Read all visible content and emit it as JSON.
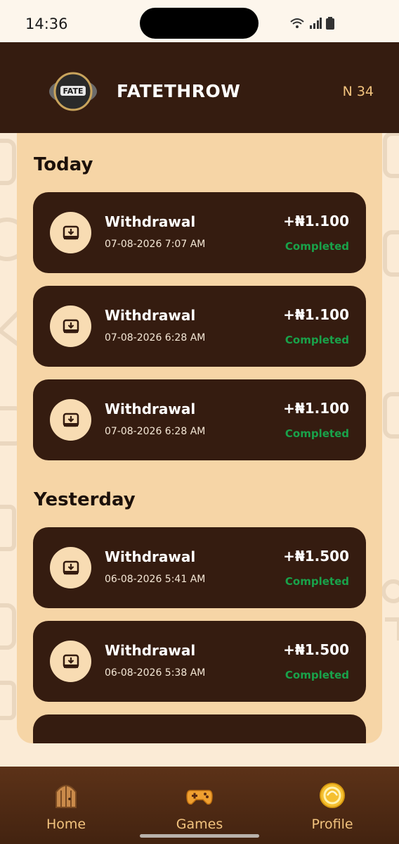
{
  "status_bar": {
    "time": "14:36"
  },
  "header": {
    "app_title": "FATETHROW",
    "logo_text": "FATE",
    "balance": "N 34"
  },
  "sections": [
    {
      "title": "Today",
      "transactions": [
        {
          "type": "Withdrawal",
          "date": "07-08-2026 7:07 AM",
          "amount": "+₦1.100",
          "status": "Completed"
        },
        {
          "type": "Withdrawal",
          "date": "07-08-2026 6:28 AM",
          "amount": "+₦1.100",
          "status": "Completed"
        },
        {
          "type": "Withdrawal",
          "date": "07-08-2026 6:28 AM",
          "amount": "+₦1.100",
          "status": "Completed"
        }
      ]
    },
    {
      "title": "Yesterday",
      "transactions": [
        {
          "type": "Withdrawal",
          "date": "06-08-2026 5:41 AM",
          "amount": "+₦1.500",
          "status": "Completed"
        },
        {
          "type": "Withdrawal",
          "date": "06-08-2026 5:38 AM",
          "amount": "+₦1.500",
          "status": "Completed"
        }
      ]
    }
  ],
  "bottom_nav": {
    "items": [
      {
        "label": "Home",
        "icon": "door-icon"
      },
      {
        "label": "Games",
        "icon": "gamepad-icon"
      },
      {
        "label": "Profile",
        "icon": "coin-icon"
      }
    ]
  },
  "colors": {
    "header_bg": "#351c10",
    "panel_bg": "#f6d5a6",
    "card_bg": "#351c10",
    "status_completed": "#19a24a",
    "accent": "#f2c37e"
  }
}
